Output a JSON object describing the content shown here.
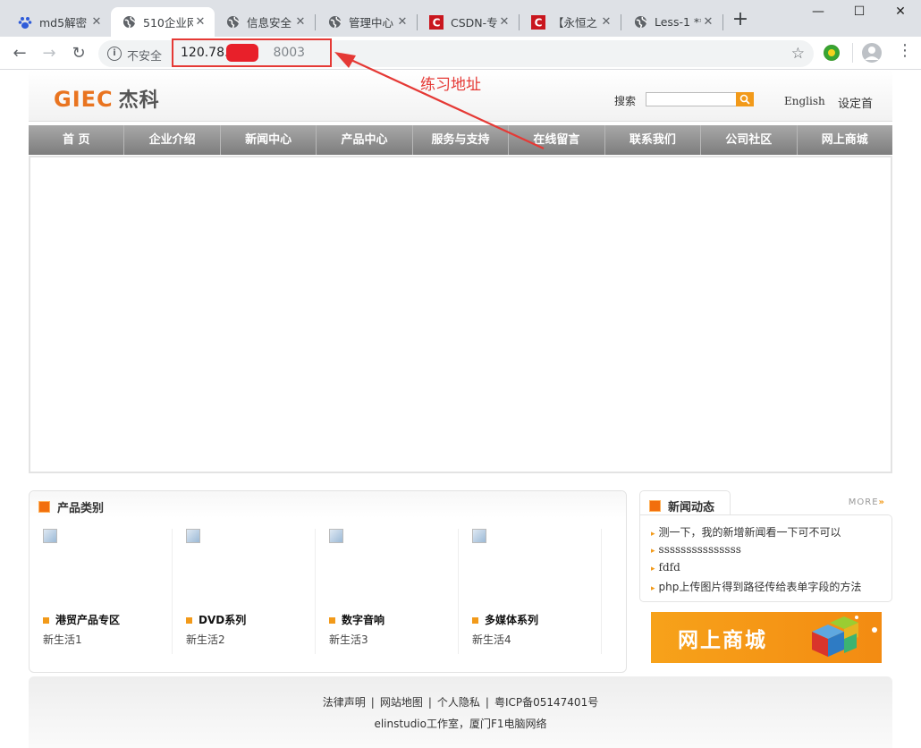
{
  "browser": {
    "tabs": [
      {
        "title": "md5解密",
        "icon": "baidu-paw-icon"
      },
      {
        "title": "510企业网",
        "icon": "globe-icon"
      },
      {
        "title": "信息安全",
        "icon": "globe-icon"
      },
      {
        "title": "管理中心",
        "icon": "globe-icon"
      },
      {
        "title": "CSDN-专",
        "icon": "csdn-icon"
      },
      {
        "title": "【永恒之",
        "icon": "csdn-icon"
      },
      {
        "title": "Less-1 **",
        "icon": "globe-icon"
      }
    ],
    "new_tab": "+",
    "insecure_label": "不安全",
    "url_visible": "120.78.",
    "url_tail": "8003"
  },
  "annotation": {
    "text": "练习地址"
  },
  "site": {
    "logo_latin": "GIEC",
    "logo_cn": "杰科",
    "search_label": "搜索",
    "search_button": "Q",
    "lang": "English",
    "set_home": "设定首",
    "nav": [
      "首 页",
      "企业介绍",
      "新闻中心",
      "产品中心",
      "服务与支持",
      "在线留言",
      "联系我们",
      "公司社区",
      "网上商城"
    ],
    "products": {
      "title": "产品类别",
      "items": [
        {
          "name": "港贸产品专区",
          "desc": "新生活1"
        },
        {
          "name": "DVD系列",
          "desc": "新生活2"
        },
        {
          "name": "数字音响",
          "desc": "新生活3"
        },
        {
          "name": "多媒体系列",
          "desc": "新生活4"
        }
      ]
    },
    "news": {
      "title": "新闻动态",
      "more": "MORE",
      "items": [
        "测一下，我的新增新闻看一下可不可以",
        "sssssssssssssss",
        "fdfd",
        "php上传图片得到路径传给表单字段的方法"
      ]
    },
    "shop_ad": "网上商城",
    "footer": {
      "links": [
        "法律声明",
        "网站地图",
        "个人隐私",
        "粤ICP备05147401号"
      ],
      "copyright": "elinstudio工作室，厦门F1电脑网络"
    }
  },
  "colors": {
    "accent": "#f29a1a",
    "logo_orange": "#e97420",
    "annotation_red": "#e53935"
  }
}
